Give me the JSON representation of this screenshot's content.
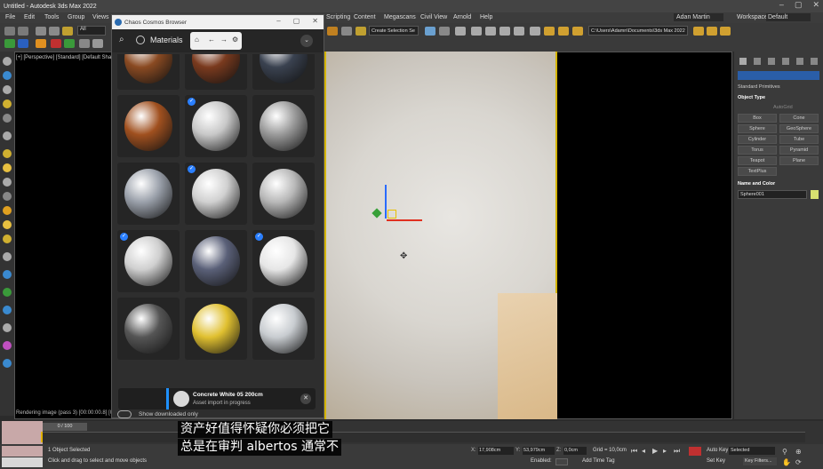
{
  "window": {
    "title": "Untitled - Autodesk 3ds Max 2022"
  },
  "menu": [
    "File",
    "Edit",
    "Tools",
    "Group",
    "Views",
    "Scripting",
    "Content",
    "Megascans",
    "Civil View",
    "Arnold",
    "Help"
  ],
  "account": {
    "user": "Adan Martin",
    "workspace_label": "Workspaces:",
    "workspace_value": "Default"
  },
  "toolbar": {
    "filter_value": "All",
    "selection_set": "Create Selection Se",
    "project_path": "C:\\Users\\Adamn\\Documents\\3ds Max 2022"
  },
  "viewport": {
    "label": "[+] [Perspective] [Standard] [Default Shad",
    "status": "Rendering image (pass 3) [00:00:00.8] [02:"
  },
  "cosmos": {
    "title": "Chaos Cosmos Browser",
    "section": "Materials",
    "download_name": "Concrete White 05 200cm",
    "download_status": "Asset import in progress",
    "footer_label": "Show downloaded only"
  },
  "materials": [
    {
      "color": "#8a4a22",
      "checked": false
    },
    {
      "color": "#7a3a1e",
      "checked": false
    },
    {
      "color": "#3a4250",
      "checked": false
    },
    {
      "color": "#a0501f",
      "checked": false
    },
    {
      "color": "#c8c8c8",
      "checked": true
    },
    {
      "color": "#9a9a9a",
      "checked": false
    },
    {
      "color": "#9aa0aa",
      "checked": false
    },
    {
      "color": "#d0d0d0",
      "checked": true
    },
    {
      "color": "#b8b8b8",
      "checked": false
    },
    {
      "color": "#cfcfcf",
      "checked": true
    },
    {
      "color": "#5a6078",
      "checked": false
    },
    {
      "color": "#e6e6e6",
      "checked": true
    },
    {
      "color": "#555555",
      "checked": false
    },
    {
      "color": "#e0c030",
      "checked": false
    },
    {
      "color": "#c8ccd0",
      "checked": false
    }
  ],
  "command_panel": {
    "category": "Standard Primitives",
    "object_type_header": "Object Type",
    "autogrid": "AutoGrid",
    "buttons": [
      "Box",
      "Cone",
      "Sphere",
      "GeoSphere",
      "Cylinder",
      "Tube",
      "Torus",
      "Pyramid",
      "Teapot",
      "Plane",
      "TextPlus"
    ],
    "name_color_header": "Name and Color",
    "object_name": "Sphere001"
  },
  "timeline": {
    "frame": "0 / 100"
  },
  "status": {
    "selected": "1 Object Selected",
    "hint": "Click and drag to select and move objects",
    "x": "17,908cm",
    "y": "53,979cm",
    "z": "0,0cm",
    "grid": "Grid = 10,0cm",
    "enabled": "Enabled:",
    "add_time_tag": "Add Time Tag",
    "autokey": "Auto Key",
    "setkey": "Set Key",
    "selected_dropdown": "Selected",
    "key_filters": "Key Filters..."
  },
  "subtitles": [
    "资产好值得怀疑你必须把它",
    "总是在审判 albertos 通常不"
  ]
}
